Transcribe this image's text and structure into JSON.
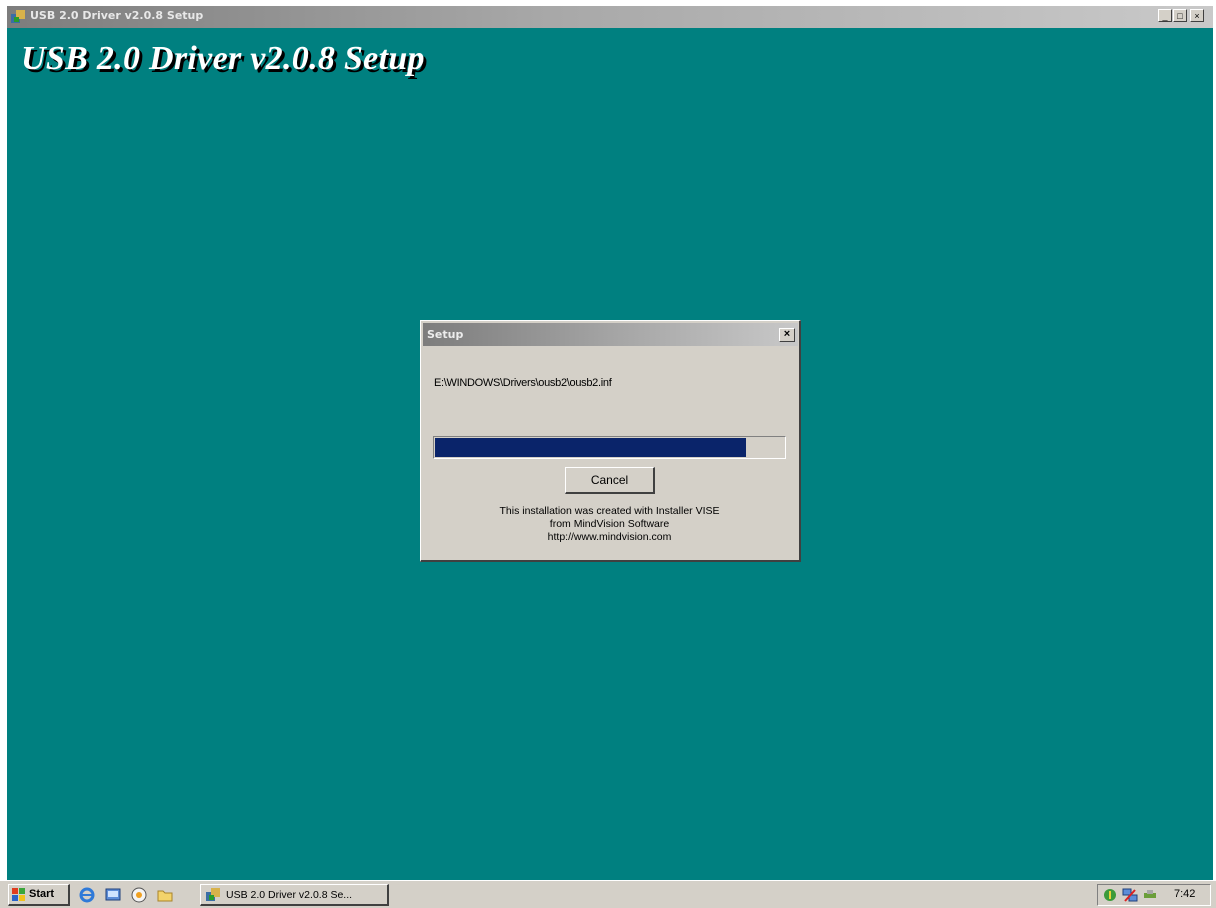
{
  "main_window": {
    "title": "USB 2.0 Driver v2.0.8 Setup",
    "heading": "USB 2.0 Driver v2.0.8 Setup",
    "background_color": "#008080",
    "caption_buttons": {
      "minimize": "_",
      "maximize": "□",
      "close": "×"
    }
  },
  "dialog": {
    "title": "Setup",
    "close_label": "×",
    "file_path": "E:\\WINDOWS\\Drivers\\ousb2\\ousb2.inf",
    "progress": 0.89,
    "progress_color": "#0a246a",
    "cancel_label": "Cancel",
    "credits": [
      "This installation was created with Installer VISE",
      "from MindVision Software",
      "http://www.mindvision.com"
    ]
  },
  "taskbar": {
    "start_label": "Start",
    "quick_launch": [
      "internet-explorer-icon",
      "desktop-icon",
      "media-player-icon",
      "folder-icon"
    ],
    "task_button_label": "USB 2.0 Driver v2.0.8 Se...",
    "tray_icons": [
      "security-icon",
      "network-icon",
      "usb-icon"
    ],
    "clock": "7:42"
  }
}
